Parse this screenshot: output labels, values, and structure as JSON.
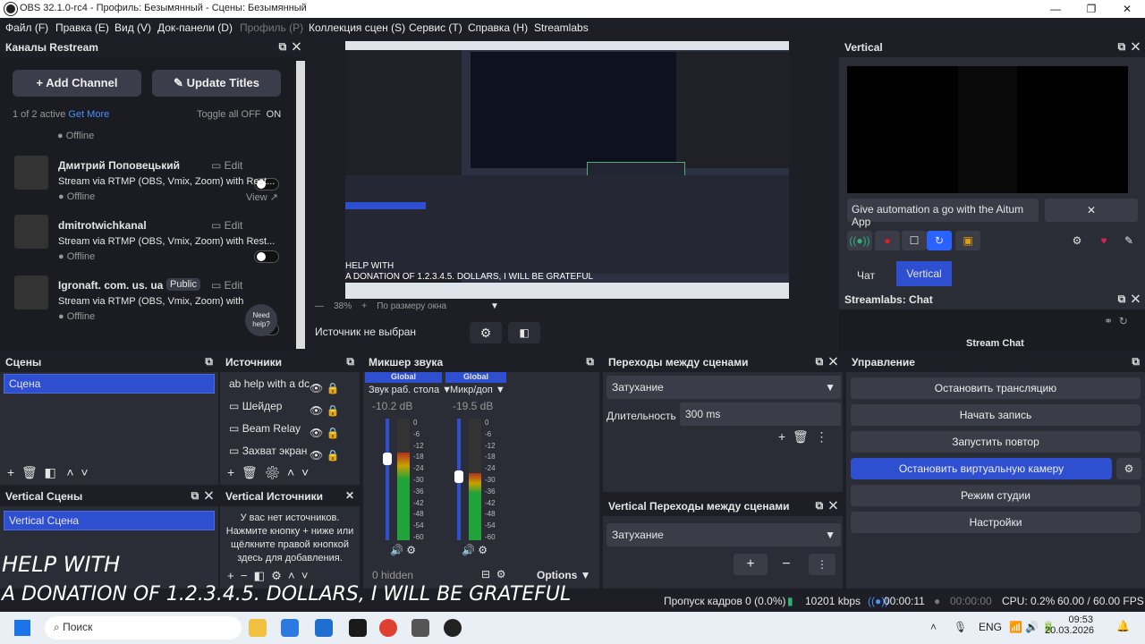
{
  "window": {
    "title": "OBS 32.1.0-rc4 - Профиль: Безымянный - Сцены: Безымянный"
  },
  "menu": [
    "Файл (F)",
    "Правка (E)",
    "Вид (V)",
    "Док-панели (D)",
    "Профиль (P)",
    "Коллекция сцен (S)",
    "Сервис (T)",
    "Справка (H)",
    "Streamlabs"
  ],
  "restream": {
    "title": "Каналы Restream",
    "add_channel": "Add Channel",
    "update_titles": "Update Titles",
    "active": "1 of 2 active",
    "get_more": "Get More",
    "toggle_all": "Toggle all OFF",
    "on": "ON",
    "offline": "Offline",
    "channels": [
      {
        "name": "Дмитрий Поповецький",
        "desc": "Stream via RTMP (OBS, Vmix, Zoom) with Rest...",
        "status": "Offline",
        "edit": "Edit",
        "view": "View"
      },
      {
        "name": "dmitrotwichkanal",
        "desc": "Stream via RTMP (OBS, Vmix, Zoom) with Rest...",
        "status": "Offline",
        "edit": "Edit"
      },
      {
        "name": "Igronaft. com. us. ua",
        "badge": "Public",
        "desc": "Stream via RTMP (OBS, Vmix, Zoom) with Re",
        "status": "Offline",
        "edit": "Edit"
      }
    ],
    "need_help": "Need help?"
  },
  "preview": {
    "zoom": "38%",
    "fit": "По размеру окна",
    "no_source": "Источник не выбран",
    "overlay1": "HELP WITH",
    "overlay2": "A DONATION OF 1.2.3.4.5. DOLLARS, I WILL BE GRATEFUL"
  },
  "vertical": {
    "title": "Vertical",
    "input_text": "Give automation a go with the Aitum App",
    "tabs": [
      "Чат",
      "Vertical"
    ]
  },
  "slchat": {
    "title": "Streamlabs: Chat",
    "label": "Stream Chat"
  },
  "scenes": {
    "title": "Сцены",
    "items": [
      "Сцена"
    ]
  },
  "sources": {
    "title": "Источники",
    "items": [
      "help with a dc",
      "Шейдер",
      "Beam Relay",
      "Захват экран"
    ]
  },
  "mixer": {
    "title": "Микшер звука",
    "channels": [
      {
        "tag": "Global",
        "name": "Звук раб. стола",
        "db": "-10.2 dB",
        "level": 0.72
      },
      {
        "tag": "Global",
        "name": "Микр/доп",
        "db": "-19.5 dB",
        "level": 0.55
      }
    ],
    "scale": [
      "0",
      "-6",
      "-12",
      "-18",
      "-24",
      "-30",
      "-36",
      "-42",
      "-48",
      "-54",
      "-60"
    ],
    "hidden": "0 hidden",
    "options": "Options"
  },
  "transitions": {
    "title": "Переходы между сценами",
    "select": "Затухание",
    "duration_label": "Длительность",
    "duration": "300 ms"
  },
  "vtransitions": {
    "title": "Vertical Переходы между сценами",
    "select": "Затухание"
  },
  "control": {
    "title": "Управление",
    "buttons": [
      "Остановить трансляцию",
      "Начать запись",
      "Запустить повтор",
      "Остановить виртуальную камеру",
      "Режим студии",
      "Настройки"
    ]
  },
  "vscenes": {
    "title": "Vertical Сцены",
    "items": [
      "Vertical Сцена"
    ]
  },
  "vsources": {
    "title": "Vertical Источники",
    "empty": "У вас нет источников. Нажмите кнопку + ниже или щёлкните правой кнопкой здесь для добавления."
  },
  "overlay_text": {
    "line1": "HELP WITH",
    "line2": "A DONATION OF 1.2.3.4.5. DOLLARS, I WILL BE GRATEFUL"
  },
  "status": {
    "dropped": "Пропуск кадров 0 (0.0%)",
    "kbps": "10201 kbps",
    "stream_time": "00:00:11",
    "rec_time": "00:00:00",
    "cpu": "CPU: 0.2%",
    "fps": "60.00 / 60.00 FPS"
  },
  "taskbar": {
    "search": "Поиск",
    "lang": "ENG",
    "time": "09:53",
    "date": "20.03.2026"
  }
}
